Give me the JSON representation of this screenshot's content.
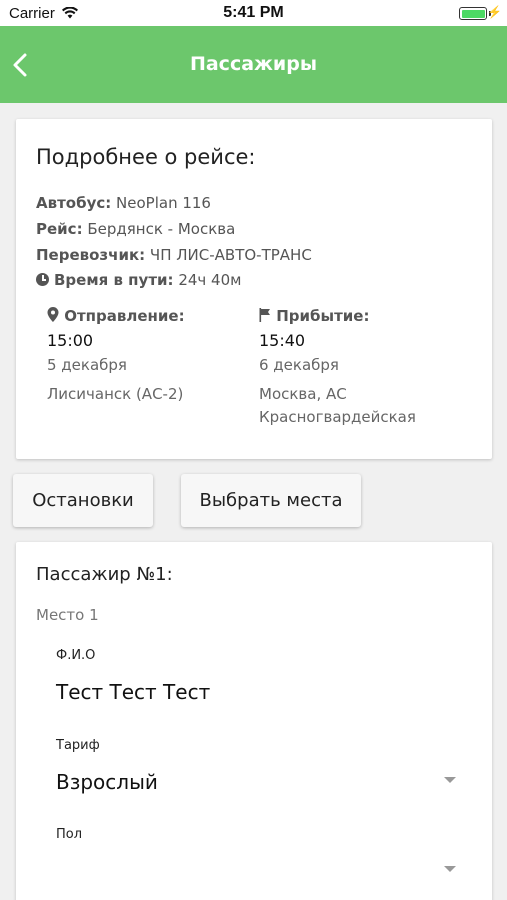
{
  "status_bar": {
    "carrier": "Carrier",
    "time": "5:41 PM",
    "battery_level": 1.0
  },
  "header": {
    "title": "Пассажиры",
    "back_icon": "chevron-left-icon"
  },
  "trip": {
    "title": "Подробнее о рейсе:",
    "bus_label": "Автобус:",
    "bus_value": "NeoPlan 116",
    "route_label": "Рейс:",
    "route_value": "Бердянск - Москва",
    "carrier_label": "Перевозчик:",
    "carrier_value": "ЧП ЛИС-АВТО-ТРАНС",
    "duration_label": "Время в пути:",
    "duration_value": "24ч 40м",
    "departure": {
      "label": "Отправление:",
      "time": "15:00",
      "date": "5 декабря",
      "place": "Лисичанск (АС-2)"
    },
    "arrival": {
      "label": "Прибытие:",
      "time": "15:40",
      "date": "6 декабря",
      "place": "Москва, АС Красногвардейская"
    }
  },
  "actions": {
    "stops_label": "Остановки",
    "seats_label": "Выбрать места"
  },
  "passenger": {
    "title": "Пассажир №1:",
    "seat": "Место 1",
    "name_label": "Ф.И.О",
    "name_value": "Тест Тест Тест",
    "tariff_label": "Тариф",
    "tariff_value": "Взрослый",
    "gender_label": "Пол",
    "gender_value": ""
  },
  "colors": {
    "header_bg": "#6cc76c",
    "battery": "#4cd964"
  }
}
